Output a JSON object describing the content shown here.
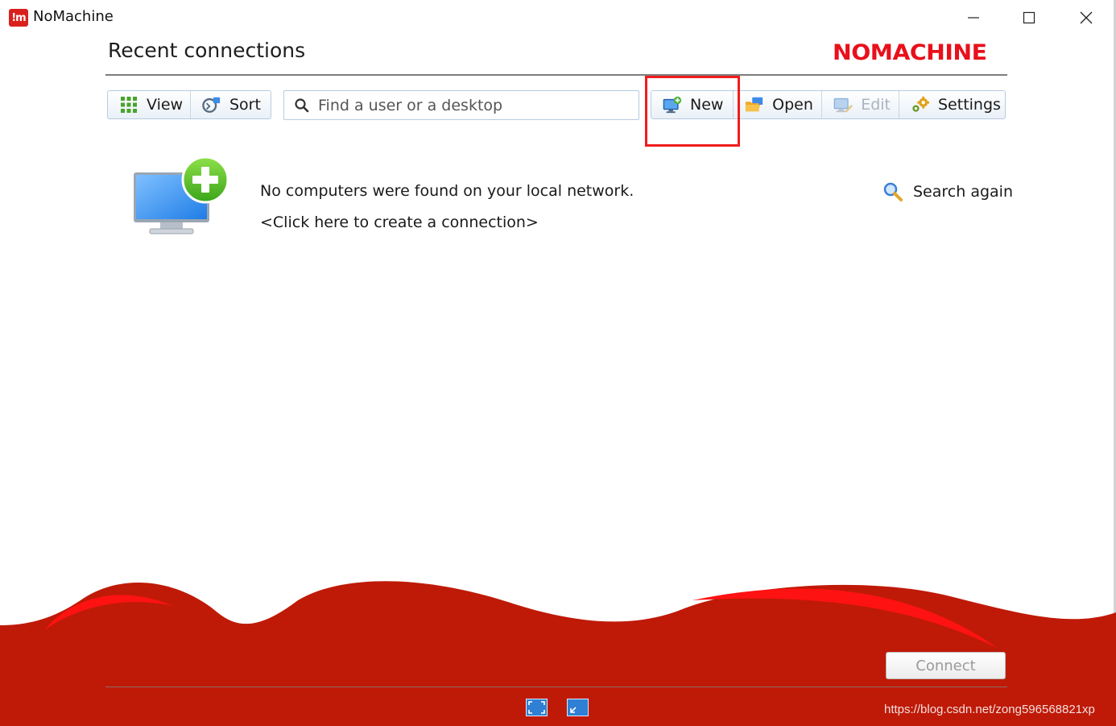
{
  "window": {
    "app_icon_text": "!m",
    "title": "NoMachine",
    "controls": {
      "minimize": "minimize",
      "maximize": "maximize",
      "close": "close"
    }
  },
  "header": {
    "title": "Recent connections",
    "brand": "NOMACHINE"
  },
  "toolbar_left": {
    "view_label": "View",
    "sort_label": "Sort"
  },
  "search": {
    "placeholder": "Find a user or a desktop",
    "value": ""
  },
  "toolbar_right": {
    "new_label": "New",
    "open_label": "Open",
    "edit_label": "Edit",
    "settings_label": "Settings",
    "edit_disabled": true
  },
  "empty_state": {
    "message": "No computers were found on your local network.",
    "create_link": "<Click here to create a connection>",
    "search_again": "Search again"
  },
  "footer": {
    "connect_label": "Connect",
    "connect_enabled": false
  },
  "watermark": "https://blog.csdn.net/zong596568821xp",
  "colors": {
    "brand_red": "#e8101b",
    "wave_red": "#bf1a07",
    "highlight_red": "#f01c1c",
    "accent_blue": "#3d8be8"
  },
  "icons": {
    "app": "nomachine-logo-icon",
    "view": "grid-view-icon",
    "sort": "sort-icon",
    "search": "search-icon",
    "new": "new-connection-monitor-icon",
    "open": "open-folder-icon",
    "edit": "edit-monitor-icon",
    "settings": "gears-icon",
    "search_again": "magnifier-icon",
    "fullscreen": "fullscreen-icon",
    "window_mode": "window-mode-icon"
  }
}
